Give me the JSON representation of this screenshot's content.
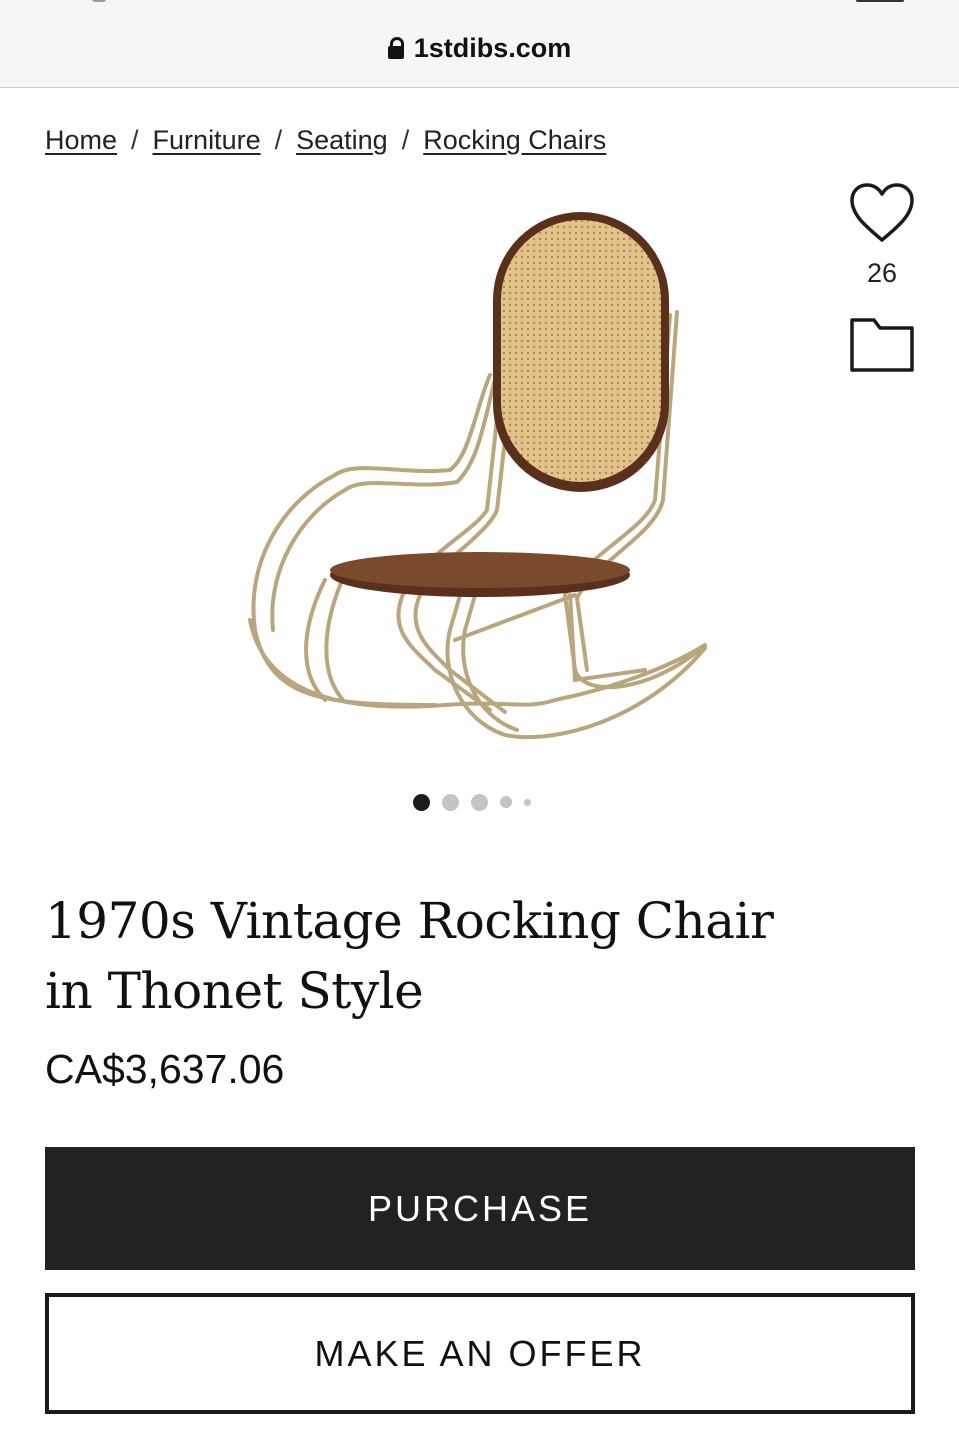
{
  "browser": {
    "url": "1stdibs.com",
    "lock_icon": "lock-icon"
  },
  "breadcrumb": {
    "items": [
      "Home",
      "Furniture",
      "Seating",
      "Rocking Chairs"
    ],
    "separator": "/"
  },
  "product": {
    "image_alt": "rocking-chair-photo",
    "favorites_count": "26",
    "favorite_icon": "heart-icon",
    "save_icon": "folder-icon",
    "carousel": {
      "total": 5,
      "active_index": 0
    },
    "title": "1970s Vintage Rocking Chair in Thonet Style",
    "price": "CA$3,637.06"
  },
  "actions": {
    "purchase_label": "PURCHASE",
    "offer_label": "MAKE AN OFFER"
  },
  "colors": {
    "primary_button": "#222222",
    "cane": "#d9b57a",
    "wood": "#5a2f1c",
    "brass": "#b9a67c"
  }
}
